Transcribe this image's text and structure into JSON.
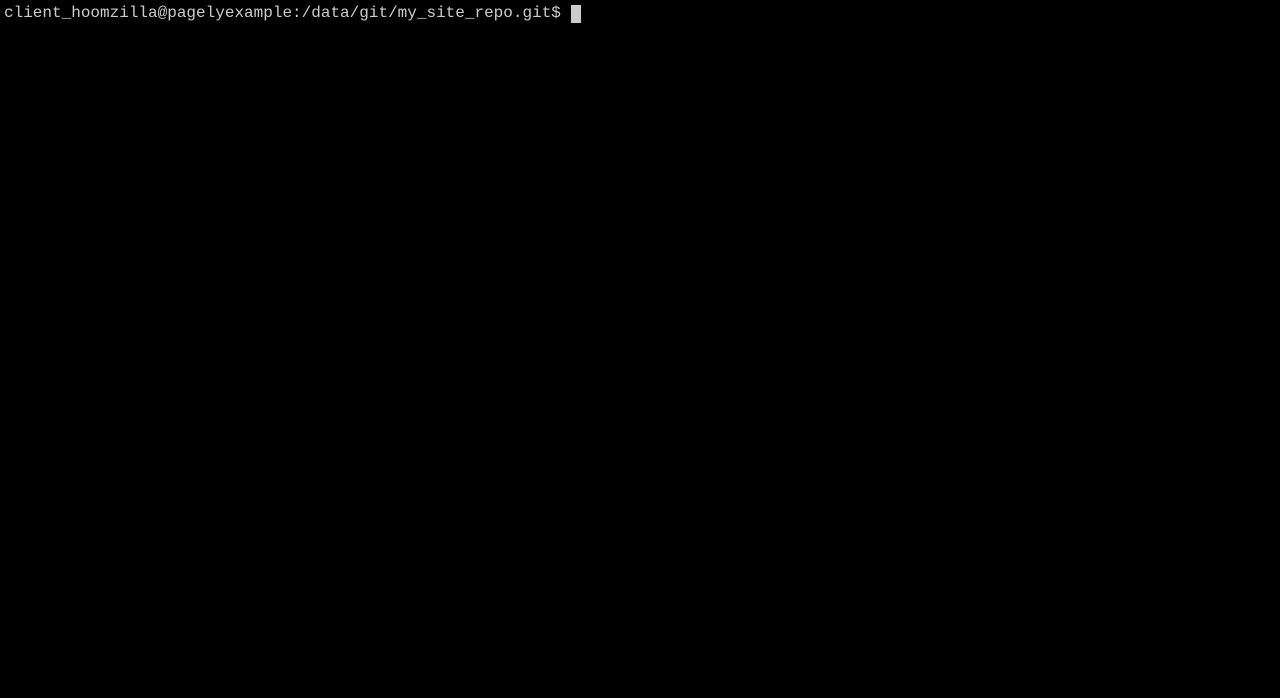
{
  "terminal": {
    "prompt": "client_hoomzilla@pagelyexample:/data/git/my_site_repo.git$",
    "command": ""
  }
}
